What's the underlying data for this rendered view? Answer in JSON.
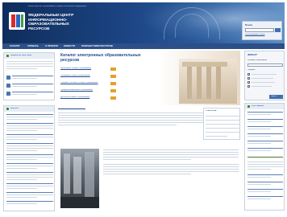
{
  "site": {
    "logo_text": "ФЕДЕРАЛЬНЫЙ ЦЕНТР ИНФОРМАЦИОННО-ОБРАЗОВАТЕЛЬНЫХ РЕСУРСОВ",
    "header_small": "Министерство образования и науки Российской Федерации",
    "search_label": "Поиск",
    "search_links": "Расширенный поиск"
  },
  "nav": {
    "items": [
      "КАТАЛОГ",
      "СЛОВАРЬ",
      "О ПРОЕКТЕ",
      "НОВОСТИ",
      "РАЗРАБОТЧИКИ РЕСУРСОВ"
    ]
  },
  "sidebar_left": {
    "box1_title": "НОВОСТИ ПОРТАЛА",
    "box2_title": "ФОРУМ"
  },
  "catalog": {
    "title": "Каталог электронных образовательных ресурсов",
    "rows": [
      "Начальное общее образование",
      "Основное общее образование",
      "Среднее (полное) общее образование",
      "Профессиональное образование",
      "Дополнительное образование"
    ],
    "counts": [
      "",
      "",
      "",
      "",
      ""
    ]
  },
  "right_panel": {
    "title": "ФИЛЬТР",
    "label1": "Уровень образования",
    "label2": "Предмет",
    "button": "Найти"
  },
  "stats": {
    "title": "Статистика",
    "rows": [
      "",
      "",
      "",
      "",
      ""
    ]
  },
  "partners": {
    "title": "ПАРТНЕРЫ"
  },
  "colors": {
    "header_bg": "#1a3f7a",
    "nav_bg": "#2c4f87",
    "accent_green": "#3f7d2e",
    "link_blue": "#1e4b8f"
  }
}
